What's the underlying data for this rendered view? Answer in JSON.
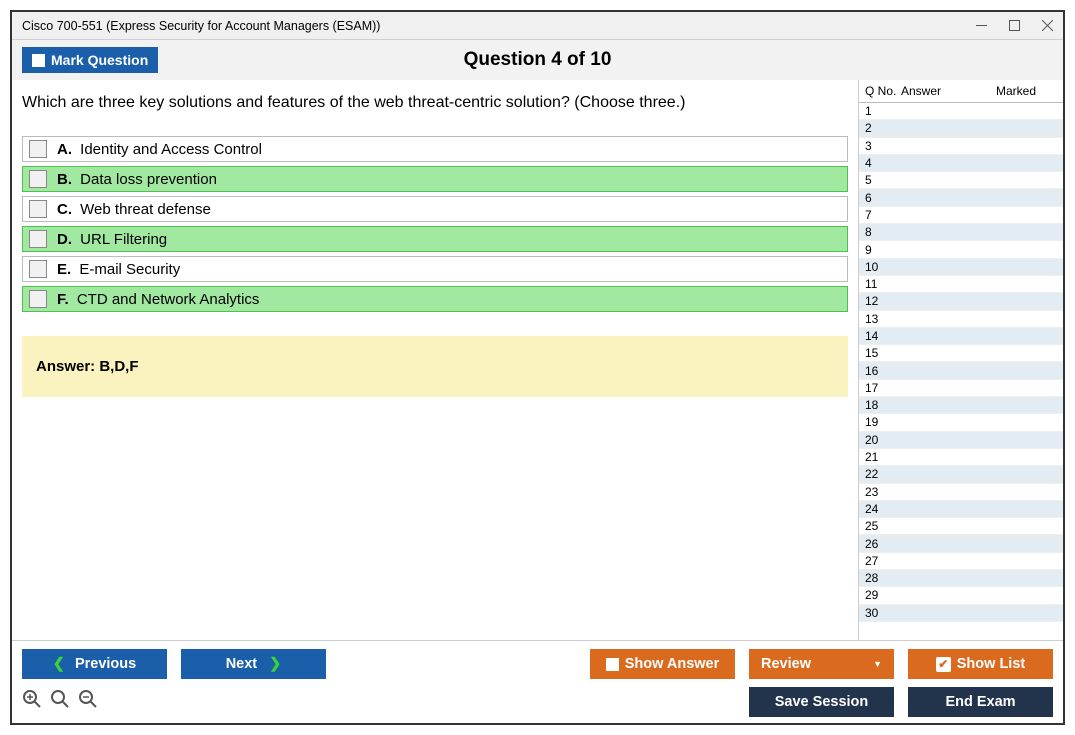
{
  "window": {
    "title": "Cisco 700-551 (Express Security for Account Managers (ESAM))"
  },
  "header": {
    "mark_button": "Mark Question",
    "question_title": "Question 4 of 10"
  },
  "question": {
    "text": "Which are three key solutions and features of the web threat-centric solution? (Choose three.)",
    "options": [
      {
        "letter": "A.",
        "text": "Identity and Access Control",
        "correct": false
      },
      {
        "letter": "B.",
        "text": "Data loss prevention",
        "correct": true
      },
      {
        "letter": "C.",
        "text": "Web threat defense",
        "correct": false
      },
      {
        "letter": "D.",
        "text": "URL Filtering",
        "correct": true
      },
      {
        "letter": "E.",
        "text": "E-mail Security",
        "correct": false
      },
      {
        "letter": "F.",
        "text": "CTD and Network Analytics",
        "correct": true
      }
    ],
    "answer_label": "Answer: B,D,F"
  },
  "sidepanel": {
    "headers": {
      "qno": "Q No.",
      "answer": "Answer",
      "marked": "Marked"
    },
    "rows": [
      1,
      2,
      3,
      4,
      5,
      6,
      7,
      8,
      9,
      10,
      11,
      12,
      13,
      14,
      15,
      16,
      17,
      18,
      19,
      20,
      21,
      22,
      23,
      24,
      25,
      26,
      27,
      28,
      29,
      30
    ]
  },
  "buttons": {
    "previous": "Previous",
    "next": "Next",
    "show_answer": "Show Answer",
    "review": "Review",
    "show_list": "Show List",
    "save_session": "Save Session",
    "end_exam": "End Exam"
  }
}
